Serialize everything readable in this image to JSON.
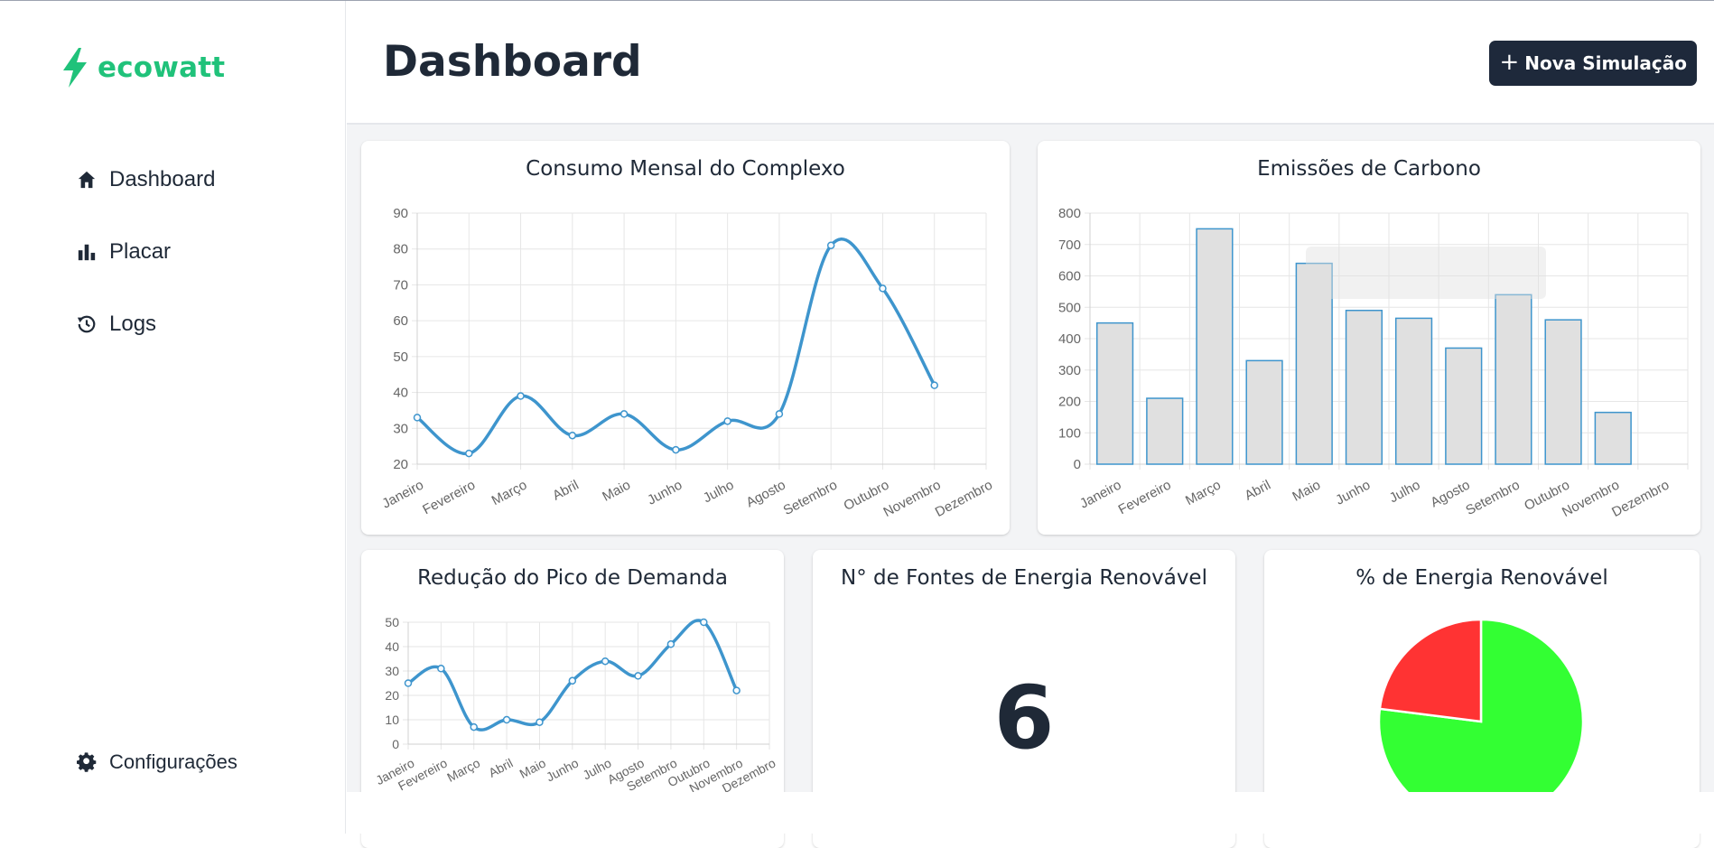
{
  "app": {
    "brand": "ecowatt",
    "brand_color": "#20c27a"
  },
  "sidebar": {
    "items": [
      {
        "label": "Dashboard",
        "icon": "home-icon"
      },
      {
        "label": "Placar",
        "icon": "bar-chart-icon"
      },
      {
        "label": "Logs",
        "icon": "history-icon"
      }
    ],
    "settings": {
      "label": "Configurações",
      "icon": "gear-icon"
    }
  },
  "header": {
    "title": "Dashboard",
    "new_button": {
      "label": "Nova Simulação",
      "icon": "plus-icon"
    }
  },
  "cards": {
    "consumo": {
      "title": "Consumo Mensal do Complexo"
    },
    "emissoes": {
      "title": "Emissões de Carbono"
    },
    "reducao": {
      "title": "Redução do Pico de Demanda"
    },
    "fontes": {
      "title": "N° de Fontes de Energia Renovável",
      "value": "6"
    },
    "renovavel": {
      "title": "% de Energia Renovável"
    }
  },
  "chart_data": [
    {
      "id": "consumo",
      "type": "line",
      "title": "Consumo Mensal do Complexo",
      "categories": [
        "Janeiro",
        "Fevereiro",
        "Março",
        "Abril",
        "Maio",
        "Junho",
        "Julho",
        "Agosto",
        "Setembro",
        "Outubro",
        "Novembro",
        "Dezembro"
      ],
      "values": [
        33,
        23,
        39,
        28,
        34,
        24,
        32,
        34,
        81,
        69,
        42,
        null
      ],
      "ylim": [
        20,
        90
      ],
      "yticks": [
        20,
        30,
        40,
        50,
        60,
        70,
        80,
        90
      ],
      "color": "#3e95cd",
      "grid": true
    },
    {
      "id": "emissoes",
      "type": "bar",
      "title": "Emissões de Carbono",
      "categories": [
        "Janeiro",
        "Fevereiro",
        "Março",
        "Abril",
        "Maio",
        "Junho",
        "Julho",
        "Agosto",
        "Setembro",
        "Outubro",
        "Novembro",
        "Dezembro"
      ],
      "values": [
        450,
        210,
        750,
        330,
        640,
        490,
        465,
        370,
        540,
        460,
        165,
        null
      ],
      "ylim": [
        0,
        800
      ],
      "yticks": [
        0,
        100,
        200,
        300,
        400,
        500,
        600,
        700,
        800
      ],
      "fill_color": "#e0e0e0",
      "border_color": "#3e95cd",
      "grid": true
    },
    {
      "id": "reducao",
      "type": "line",
      "title": "Redução do Pico de Demanda",
      "categories": [
        "Janeiro",
        "Fevereiro",
        "Março",
        "Abril",
        "Maio",
        "Junho",
        "Julho",
        "Agosto",
        "Setembro",
        "Outubro",
        "Novembro",
        "Dezembro"
      ],
      "values": [
        25,
        31,
        7,
        10,
        9,
        26,
        34,
        28,
        41,
        50,
        22,
        null
      ],
      "ylim": [
        0,
        50
      ],
      "yticks": [
        0,
        10,
        20,
        30,
        40,
        50
      ],
      "color": "#3e95cd",
      "grid": true
    },
    {
      "id": "renovavel",
      "type": "pie",
      "title": "% de Energia Renovável",
      "slices": [
        {
          "value": 77,
          "color": "#33ff33"
        },
        {
          "value": 23,
          "color": "#ff3333"
        }
      ]
    }
  ]
}
